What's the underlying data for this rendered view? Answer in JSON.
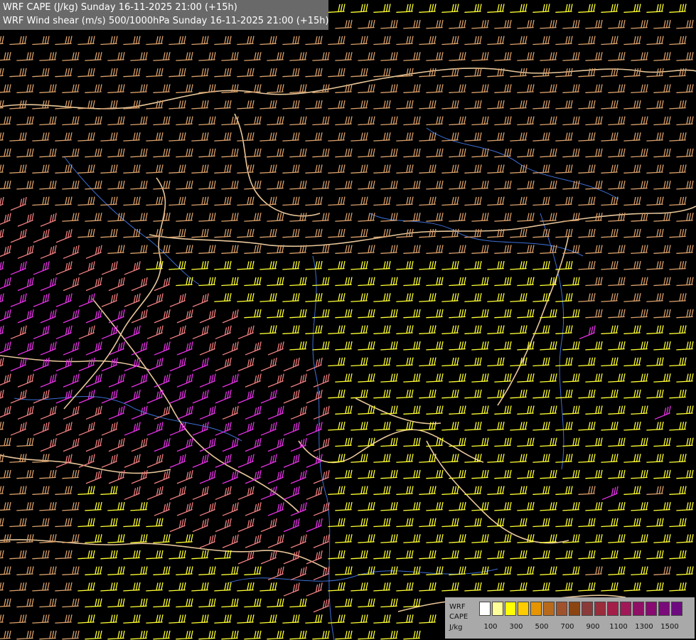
{
  "map": {
    "titles": [
      "WRF CAPE (J/kg) Sunday 16-11-2025 21:00 (+15h)",
      "WRF Wind shear (m/s) 500/1000hPa Sunday 16-11-2025 21:00 (+15h)"
    ],
    "colors": {
      "background": "#000000",
      "barb_low": "#ffff33",
      "barb_mid": "#d9a06b",
      "barb_salmon": "#f08080",
      "barb_high": "#e633e6",
      "borders": "#e8c79a",
      "rivers": "#3d6fd6"
    }
  },
  "legend": {
    "lines": [
      "WRF",
      "CAPE",
      "J/kg"
    ],
    "scale_labels": [
      "100",
      "300",
      "500",
      "700",
      "900",
      "1100",
      "1300",
      "1500"
    ],
    "scale_colors": [
      "#ffffff",
      "#ffff99",
      "#ffff00",
      "#ffcc00",
      "#e69500",
      "#b86a1c",
      "#a0522d",
      "#8b4513",
      "#8b3a3a",
      "#9b2c3c",
      "#a31f4a",
      "#a01858",
      "#901066",
      "#880a70",
      "#7a0a7a",
      "#6e0a80"
    ]
  }
}
